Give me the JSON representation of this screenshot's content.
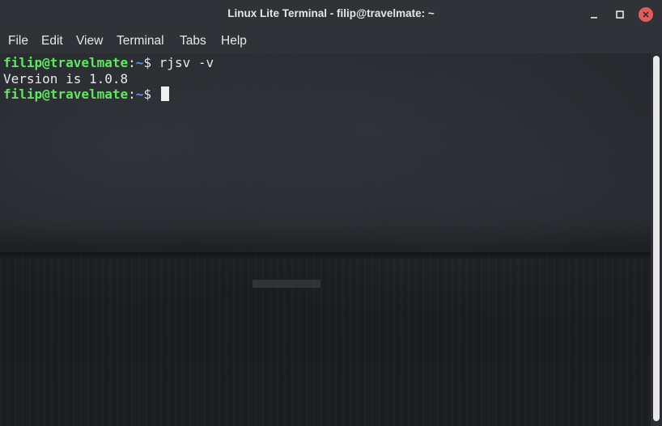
{
  "window": {
    "title": "Linux Lite Terminal - filip@travelmate: ~",
    "buttons": [
      "minimize-icon",
      "maximize-icon",
      "close-icon"
    ]
  },
  "menu": {
    "file": "File",
    "edit": "Edit",
    "view": "View",
    "terminal": "Terminal",
    "tabs": "Tabs",
    "help": "Help"
  },
  "terminal": {
    "line1": {
      "user": "filip@travelmate",
      "sep": ":",
      "path": "~",
      "prompt": "$ ",
      "command": "rjsv -v"
    },
    "line2": {
      "output": "Version is 1.0.8"
    },
    "line3": {
      "user": "filip@travelmate",
      "sep": ":",
      "path": "~",
      "prompt": "$ "
    }
  },
  "colors": {
    "user": "#5ee85e",
    "path": "#6b8cff",
    "close": "#e35b5b"
  }
}
